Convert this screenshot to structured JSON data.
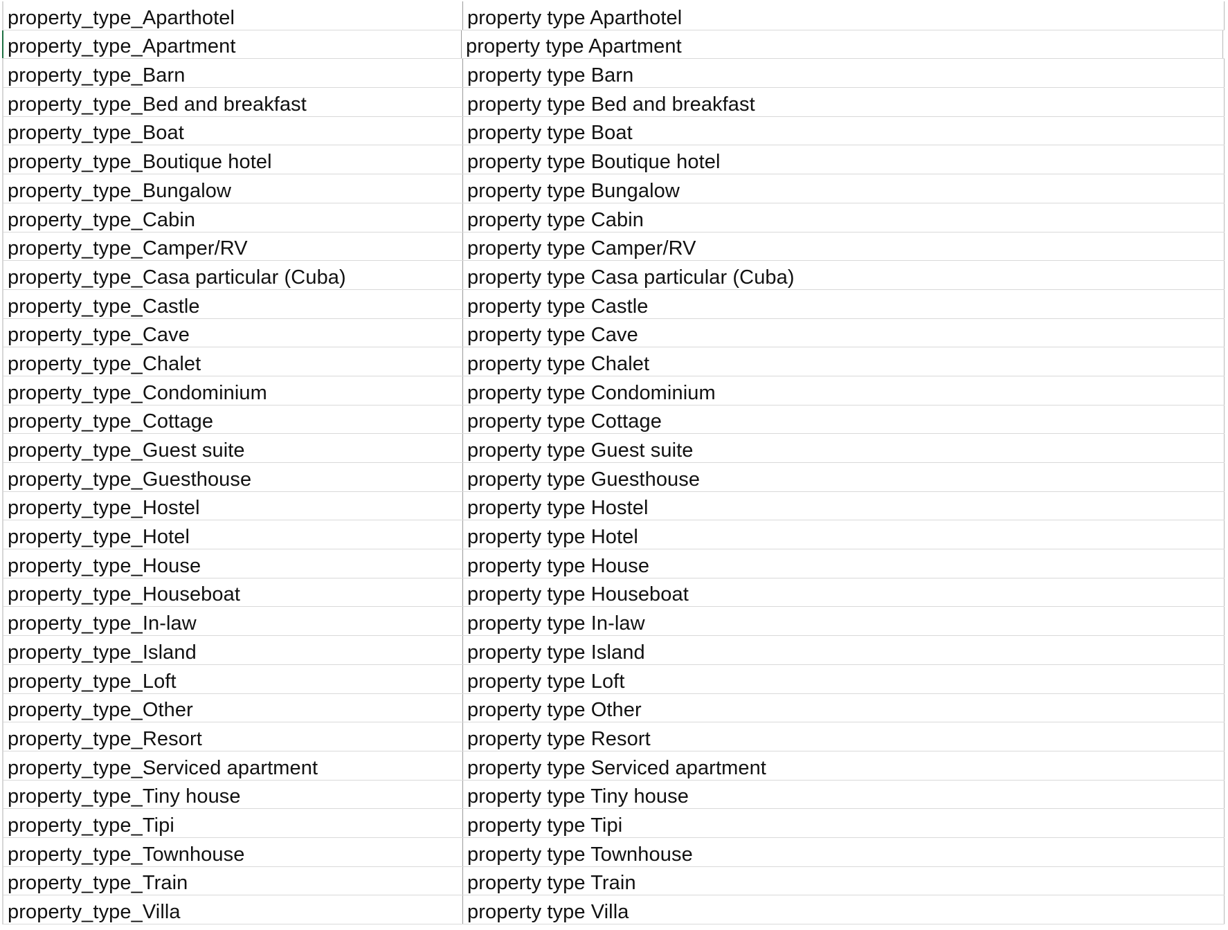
{
  "sheet": {
    "rows": [
      {
        "a": "property_type_Aparthotel",
        "b": "property type Aparthotel"
      },
      {
        "a": "property_type_Apartment",
        "b": "property type Apartment"
      },
      {
        "a": "property_type_Barn",
        "b": "property type Barn"
      },
      {
        "a": "property_type_Bed and breakfast",
        "b": "property type Bed and breakfast"
      },
      {
        "a": "property_type_Boat",
        "b": "property type Boat"
      },
      {
        "a": "property_type_Boutique hotel",
        "b": "property type Boutique hotel"
      },
      {
        "a": "property_type_Bungalow",
        "b": "property type Bungalow"
      },
      {
        "a": "property_type_Cabin",
        "b": "property type Cabin"
      },
      {
        "a": "property_type_Camper/RV",
        "b": "property type Camper/RV"
      },
      {
        "a": "property_type_Casa particular (Cuba)",
        "b": "property type Casa particular (Cuba)"
      },
      {
        "a": "property_type_Castle",
        "b": "property type Castle"
      },
      {
        "a": "property_type_Cave",
        "b": "property type Cave"
      },
      {
        "a": "property_type_Chalet",
        "b": "property type Chalet"
      },
      {
        "a": "property_type_Condominium",
        "b": "property type Condominium"
      },
      {
        "a": "property_type_Cottage",
        "b": "property type Cottage"
      },
      {
        "a": "property_type_Guest suite",
        "b": "property type Guest suite"
      },
      {
        "a": "property_type_Guesthouse",
        "b": "property type Guesthouse"
      },
      {
        "a": "property_type_Hostel",
        "b": "property type Hostel"
      },
      {
        "a": "property_type_Hotel",
        "b": "property type Hotel"
      },
      {
        "a": "property_type_House",
        "b": "property type House"
      },
      {
        "a": "property_type_Houseboat",
        "b": "property type Houseboat"
      },
      {
        "a": "property_type_In-law",
        "b": "property type In-law"
      },
      {
        "a": "property_type_Island",
        "b": "property type Island"
      },
      {
        "a": "property_type_Loft",
        "b": "property type Loft"
      },
      {
        "a": "property_type_Other",
        "b": "property type Other"
      },
      {
        "a": "property_type_Resort",
        "b": "property type Resort"
      },
      {
        "a": "property_type_Serviced apartment",
        "b": "property type Serviced apartment"
      },
      {
        "a": "property_type_Tiny house",
        "b": "property type Tiny house"
      },
      {
        "a": "property_type_Tipi",
        "b": "property type Tipi"
      },
      {
        "a": "property_type_Townhouse",
        "b": "property type Townhouse"
      },
      {
        "a": "property_type_Train",
        "b": "property type Train"
      },
      {
        "a": "property_type_Villa",
        "b": "property type Villa"
      }
    ]
  }
}
